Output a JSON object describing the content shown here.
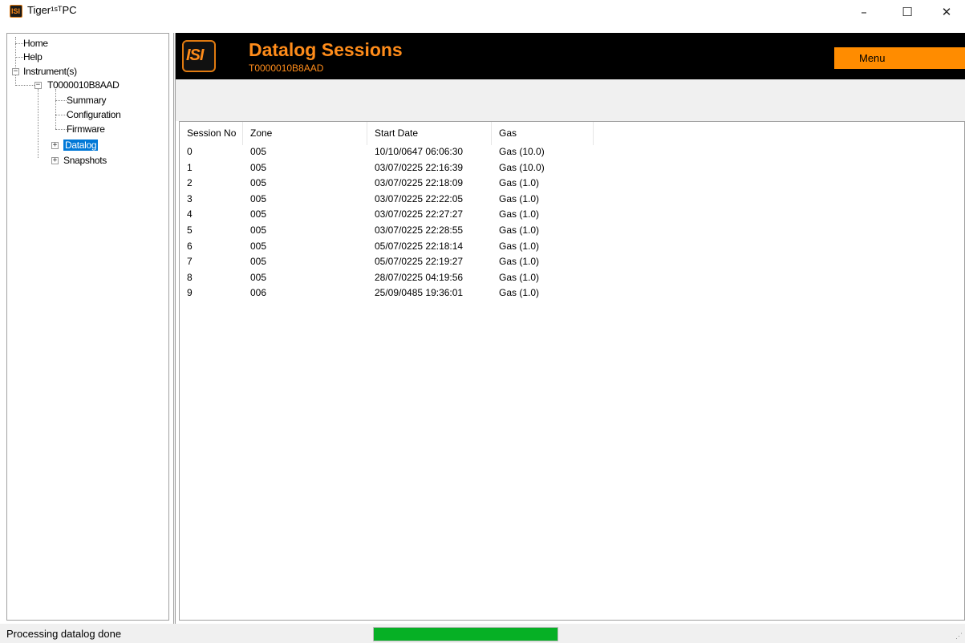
{
  "window": {
    "title": "Tiger¹ˢᵀPC",
    "logo_text": "ISI",
    "minimize_glyph": "–",
    "maximize_glyph": "☐",
    "close_glyph": "✕"
  },
  "tree": {
    "home": "Home",
    "help": "Help",
    "instruments": "Instrument(s)",
    "instrument_id": "T0000010B8AAD",
    "summary": "Summary",
    "configuration": "Configuration",
    "firmware": "Firmware",
    "datalog": "Datalog",
    "snapshots": "Snapshots",
    "expand_glyph": "+",
    "collapse_glyph": "−"
  },
  "banner": {
    "logo_text": "ISI",
    "title": "Datalog Sessions",
    "subtitle": "T0000010B8AAD",
    "menu_label": "Menu",
    "accent_color": "#ff8c1a"
  },
  "list": {
    "columns": [
      "Session No",
      "Zone",
      "Start Date",
      "Gas"
    ],
    "rows": [
      [
        "0",
        "005",
        "10/10/0647 06:06:30",
        "Gas (10.0)"
      ],
      [
        "1",
        "005",
        "03/07/0225 22:16:39",
        "Gas (10.0)"
      ],
      [
        "2",
        "005",
        "03/07/0225 22:18:09",
        "Gas (1.0)"
      ],
      [
        "3",
        "005",
        "03/07/0225 22:22:05",
        "Gas (1.0)"
      ],
      [
        "4",
        "005",
        "03/07/0225 22:27:27",
        "Gas (1.0)"
      ],
      [
        "5",
        "005",
        "03/07/0225 22:28:55",
        "Gas (1.0)"
      ],
      [
        "6",
        "005",
        "05/07/0225 22:18:14",
        "Gas (1.0)"
      ],
      [
        "7",
        "005",
        "05/07/0225 22:19:27",
        "Gas (1.0)"
      ],
      [
        "8",
        "005",
        "28/07/0225 04:19:56",
        "Gas (1.0)"
      ],
      [
        "9",
        "006",
        "25/09/0485 19:36:01",
        "Gas (1.0)"
      ]
    ]
  },
  "status": {
    "text": "Processing datalog done",
    "progress_fraction": 1.0,
    "progress_color": "#06b025"
  }
}
